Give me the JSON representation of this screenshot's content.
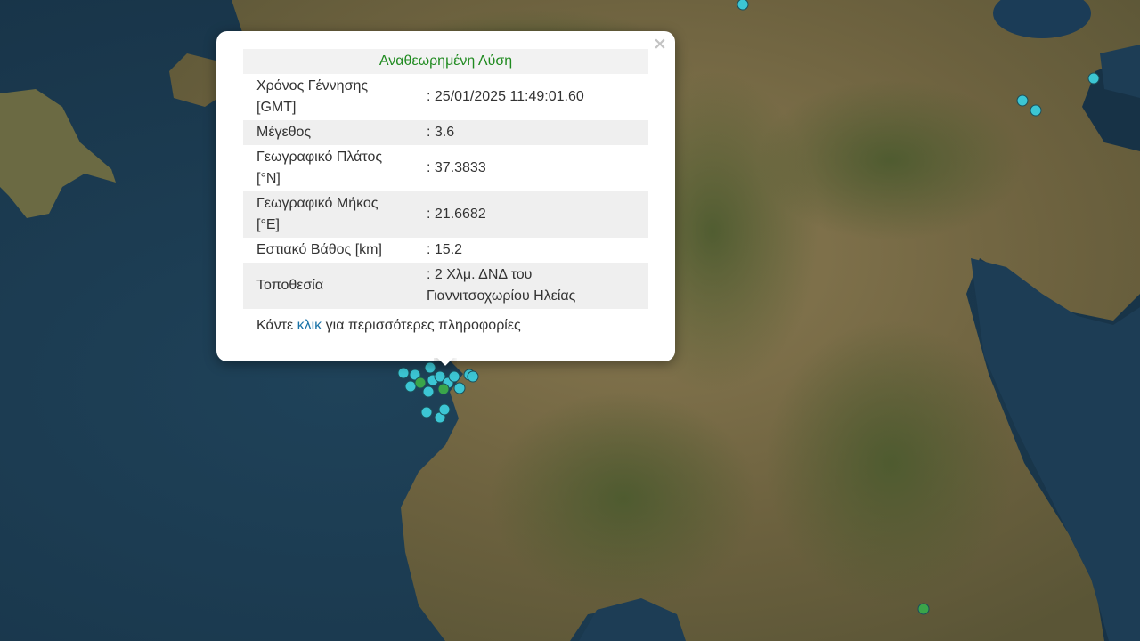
{
  "popup": {
    "title": "Αναθεωρημένη Λύση",
    "close_label": "×",
    "rows": [
      {
        "key": "Χρόνος Γέννησης [GMT]",
        "value": ": 25/01/2025 11:49:01.60"
      },
      {
        "key": "Μέγεθος",
        "value": ": 3.6"
      },
      {
        "key": "Γεωγραφικό Πλάτος [°N]",
        "value": ": 37.3833"
      },
      {
        "key": "Γεωγραφικό Μήκος [°E]",
        "value": ": 21.6682"
      },
      {
        "key": "Εστιακό Βάθος [km]",
        "value": ": 15.2"
      },
      {
        "key": "Τοποθεσία",
        "value": ": 2 Χλμ. ΔΝΔ του Γιαννιτσοχωρίου Ηλείας"
      }
    ],
    "more_prefix": "Κάντε ",
    "more_link": "κλικ",
    "more_suffix": " για περισσότερες πληροφορίες"
  },
  "colors": {
    "sea": "#1d3a4f",
    "land": "#7a6a45",
    "marker_cyan": "#3cc6d4",
    "marker_green": "#3aa54a",
    "title_green": "#1f8a1f",
    "link": "#1a73a8"
  }
}
